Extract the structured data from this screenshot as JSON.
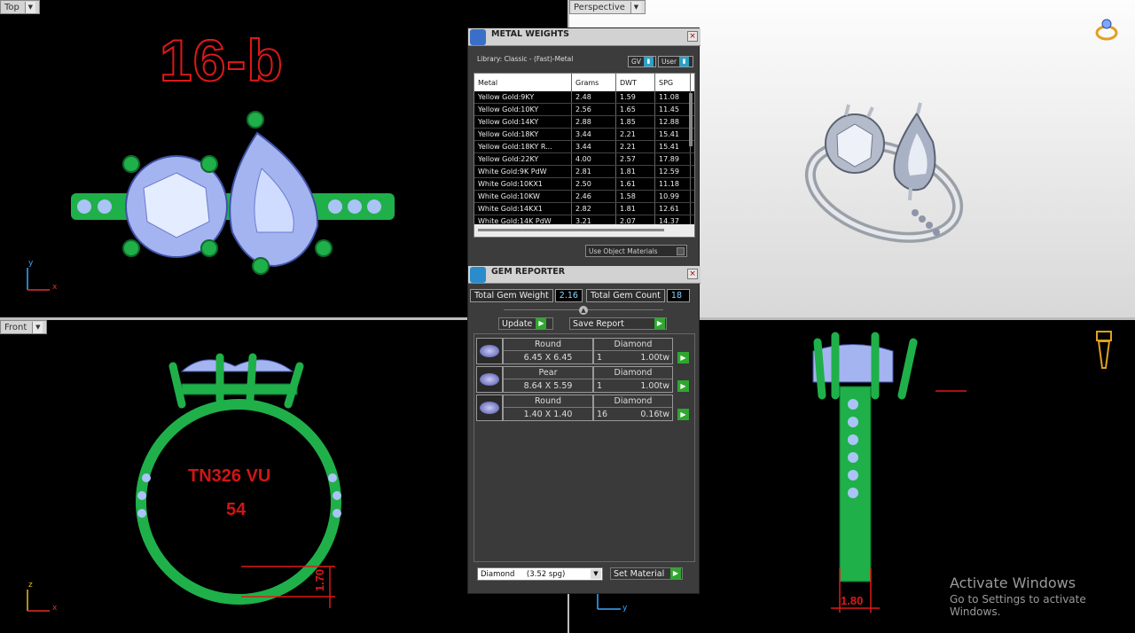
{
  "viewports": {
    "top": {
      "label": "Top",
      "title_text": "16-b",
      "axis_y": "y",
      "axis_x": "x"
    },
    "perspective": {
      "label": "Perspective"
    },
    "front": {
      "label": "Front",
      "engrave_line1": "TN326 VU",
      "engrave_line2": "54",
      "dim": "1.70",
      "axis_z": "z",
      "axis_x": "x"
    },
    "right": {
      "dim": "1.80",
      "axis_y": "y"
    }
  },
  "metal_weights": {
    "title": "METAL WEIGHTS",
    "library": "Library: Classic - (Fast)-Metal",
    "gv_label": "GV",
    "user_label": "User",
    "columns": [
      "Metal",
      "Grams",
      "DWT",
      "SPG"
    ],
    "rows": [
      [
        "Yellow Gold:9KY",
        "2.48",
        "1.59",
        "11.08"
      ],
      [
        "Yellow Gold:10KY",
        "2.56",
        "1.65",
        "11.45"
      ],
      [
        "Yellow Gold:14KY",
        "2.88",
        "1.85",
        "12.88"
      ],
      [
        "Yellow Gold:18KY",
        "3.44",
        "2.21",
        "15.41"
      ],
      [
        "Yellow Gold:18KY R...",
        "3.44",
        "2.21",
        "15.41"
      ],
      [
        "Yellow Gold:22KY",
        "4.00",
        "2.57",
        "17.89"
      ],
      [
        "White Gold:9K PdW",
        "2.81",
        "1.81",
        "12.59"
      ],
      [
        "White Gold:10KX1",
        "2.50",
        "1.61",
        "11.18"
      ],
      [
        "White Gold:10KW",
        "2.46",
        "1.58",
        "10.99"
      ],
      [
        "White Gold:14KX1",
        "2.82",
        "1.81",
        "12.61"
      ],
      [
        "White Gold:14K PdW",
        "3.21",
        "2.07",
        "14.37"
      ]
    ],
    "use_object_materials": "Use Object Materials"
  },
  "gem_reporter": {
    "title": "GEM REPORTER",
    "total_weight_label": "Total Gem Weight",
    "total_weight": "2.16",
    "total_count_label": "Total Gem Count",
    "total_count": "18",
    "update_label": "Update",
    "save_report_label": "Save Report",
    "gems": [
      {
        "shape": "Round",
        "size": "6.45 X 6.45",
        "type": "Diamond",
        "count": "1",
        "weight": "1.00tw"
      },
      {
        "shape": "Pear",
        "size": "8.64 X 5.59",
        "type": "Diamond",
        "count": "1",
        "weight": "1.00tw"
      },
      {
        "shape": "Round",
        "size": "1.40 X 1.40",
        "type": "Diamond",
        "count": "16",
        "weight": "0.16tw"
      }
    ],
    "material_select": "Diamond     (3.52 spg)",
    "set_material_label": "Set Material"
  },
  "watermark": {
    "line1": "Activate Windows",
    "line2": "Go to Settings to activate Windows."
  }
}
